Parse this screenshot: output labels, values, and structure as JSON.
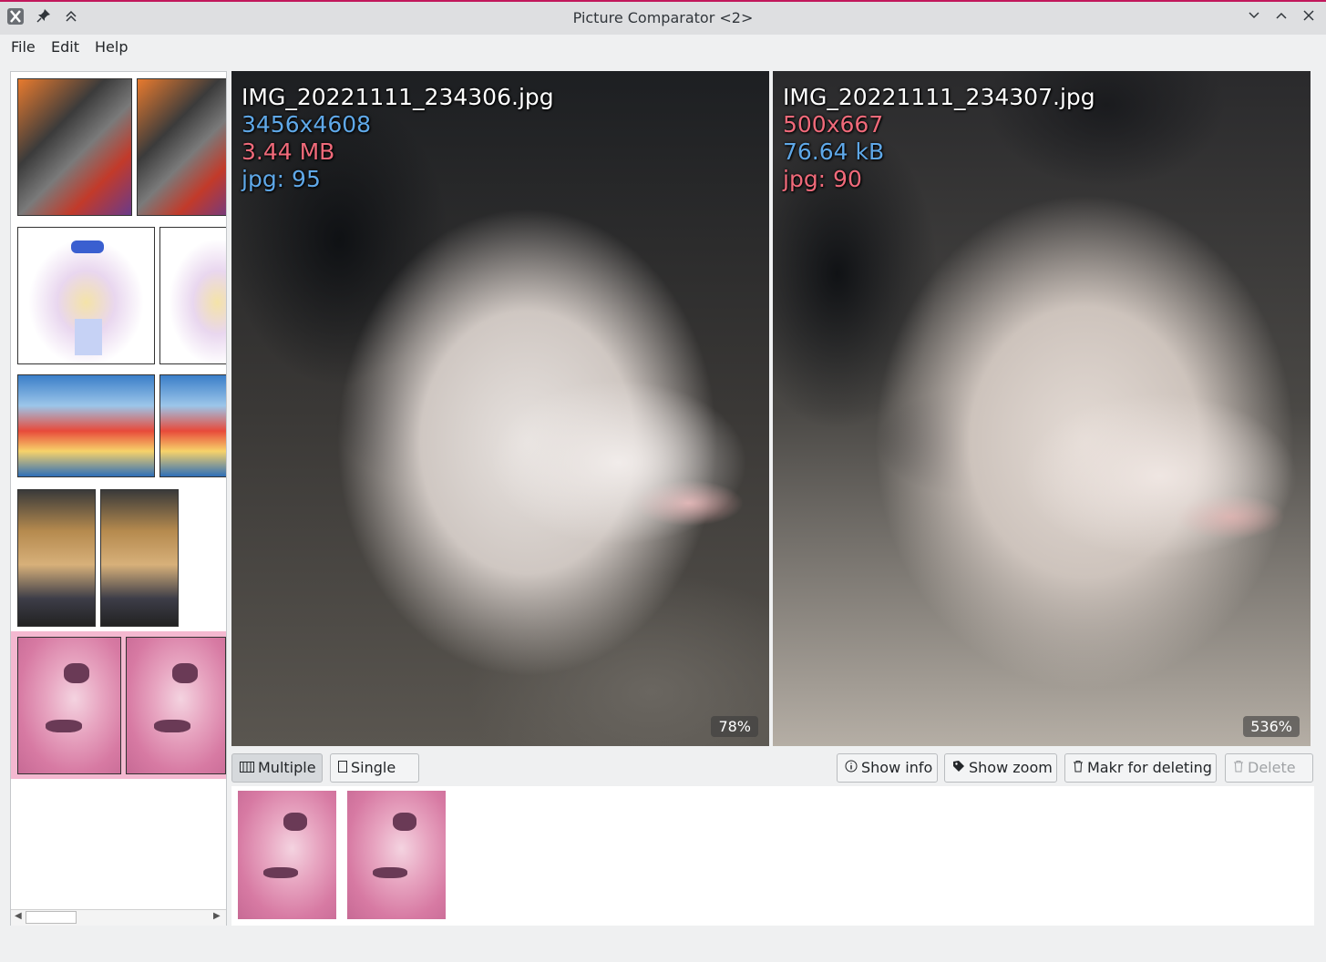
{
  "window": {
    "title": "Picture Comparator <2>"
  },
  "menu": {
    "file": "File",
    "edit": "Edit",
    "help": "Help"
  },
  "titlebar_icons": [
    "app-logo-icon",
    "pin-icon",
    "keep-above-icon",
    "minimize-icon",
    "maximize-icon",
    "close-icon"
  ],
  "colors": {
    "accent": "#c2185b",
    "selection": "#f4b8d0",
    "good": "#5fa8e8",
    "bad": "#f06a7a"
  },
  "left_image": {
    "filename": "IMG_20221111_234306.jpg",
    "resolution": "3456x4608",
    "size": "3.44 MB",
    "quality": "jpg: 95",
    "zoom": "78%"
  },
  "right_image": {
    "filename": "IMG_20221111_234307.jpg",
    "resolution": "500x667",
    "size": "76.64 kB",
    "quality": "jpg: 90",
    "zoom": "536%"
  },
  "buttons": {
    "multiple": "Multiple",
    "single": "Single",
    "show_info": "Show info",
    "show_zoom": "Show zoom",
    "mark_delete": "Makr for deleting",
    "delete": "Delete"
  }
}
